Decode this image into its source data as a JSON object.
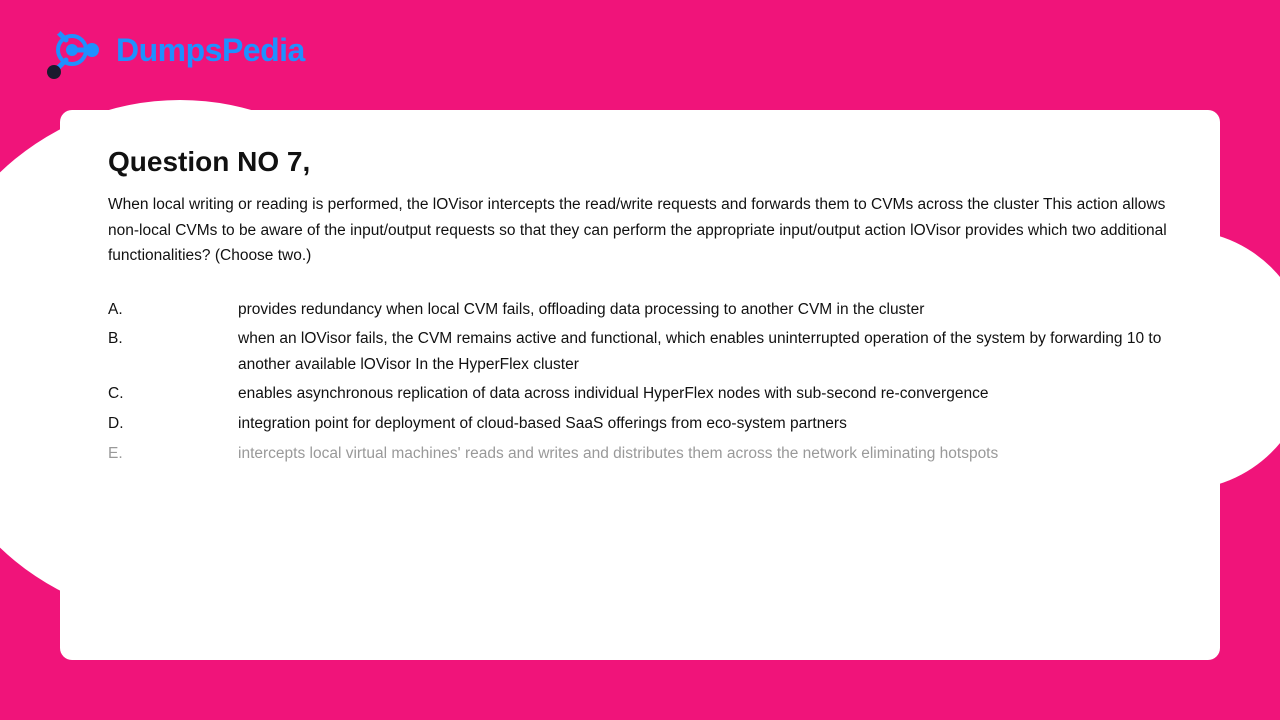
{
  "logo": {
    "text_dark": "Dumps",
    "text_blue": "Pedia"
  },
  "question": {
    "title": "Question NO 7,",
    "body": "When local writing or reading is performed, the lOVisor intercepts the read/write requests and forwards them to CVMs across the cluster This action allows non-local CVMs to be aware of the input/output requests so that they can perform the appropriate input/output action lOVisor provides which two additional functionalities? (Choose two.)",
    "options": [
      {
        "label": "A.",
        "text": "provides redundancy when local CVM fails, offloading data processing to another CVM in the cluster",
        "greyed": false
      },
      {
        "label": "B.",
        "text": "when an lOVisor fails, the CVM remains active and functional, which enables uninterrupted operation of the system by forwarding 10 to another available lOVisor In the HyperFlex cluster",
        "greyed": false
      },
      {
        "label": "C.",
        "text": "enables asynchronous replication of data across individual HyperFlex nodes with sub-second re-convergence",
        "greyed": false
      },
      {
        "label": "D.",
        "text": "integration point for deployment of cloud-based SaaS offerings from eco-system partners",
        "greyed": false
      },
      {
        "label": "E.",
        "text": "intercepts local virtual machines' reads and writes and distributes them across the network eliminating hotspots",
        "greyed": true
      }
    ]
  }
}
